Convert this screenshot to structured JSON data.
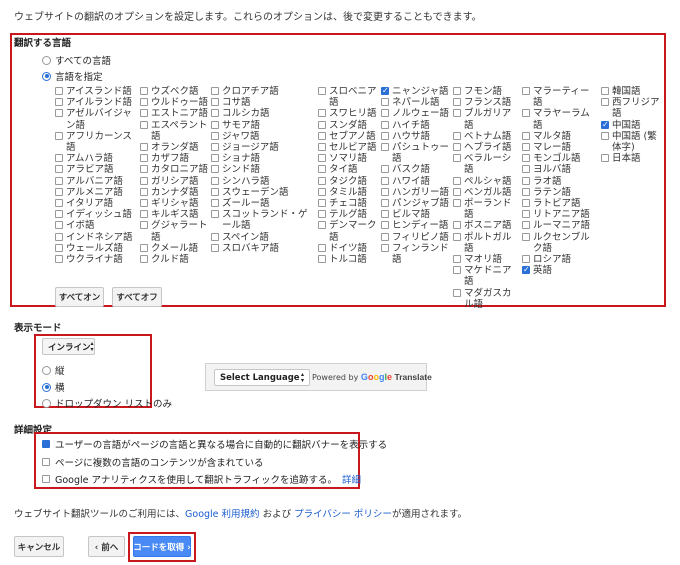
{
  "intro": "ウェブサイトの翻訳のオプションを設定します。これらのオプションは、後で変更することもできます。",
  "languages_section": {
    "title": "翻訳する言語",
    "all_languages": "すべての言語",
    "specify_languages": "言語を指定",
    "columns": [
      [
        {
          "label": "アイスランド語",
          "checked": false
        },
        {
          "label": "アイルランド語",
          "checked": false
        },
        {
          "label": "アゼルバイジャン語",
          "checked": false
        },
        {
          "label": "アフリカーンス語",
          "checked": false
        },
        {
          "label": "アムハラ語",
          "checked": false
        },
        {
          "label": "アラビア語",
          "checked": false
        },
        {
          "label": "アルバニア語",
          "checked": false
        },
        {
          "label": "アルメニア語",
          "checked": false
        },
        {
          "label": "イタリア語",
          "checked": false
        },
        {
          "label": "イディッシュ語",
          "checked": false
        },
        {
          "label": "イボ語",
          "checked": false
        },
        {
          "label": "インドネシア語",
          "checked": false
        },
        {
          "label": "ウェールズ語",
          "checked": false
        },
        {
          "label": "ウクライナ語",
          "checked": false
        }
      ],
      [
        {
          "label": "ウズベク語",
          "checked": false
        },
        {
          "label": "ウルドゥー語",
          "checked": false
        },
        {
          "label": "エストニア語",
          "checked": false
        },
        {
          "label": "エスペラント語",
          "checked": false
        },
        {
          "label": "オランダ語",
          "checked": false
        },
        {
          "label": "カザフ語",
          "checked": false
        },
        {
          "label": "カタロニア語",
          "checked": false
        },
        {
          "label": "ガリシア語",
          "checked": false
        },
        {
          "label": "カンナダ語",
          "checked": false
        },
        {
          "label": "ギリシャ語",
          "checked": false
        },
        {
          "label": "キルギス語",
          "checked": false
        },
        {
          "label": "グジャラート語",
          "checked": false
        },
        {
          "label": "クメール語",
          "checked": false
        },
        {
          "label": "クルド語",
          "checked": false
        }
      ],
      [
        {
          "label": "クロアチア語",
          "checked": false
        },
        {
          "label": "コサ語",
          "checked": false
        },
        {
          "label": "コルシカ語",
          "checked": false
        },
        {
          "label": "サモア語",
          "checked": false
        },
        {
          "label": "ジャワ語",
          "checked": false
        },
        {
          "label": "ジョージア語",
          "checked": false
        },
        {
          "label": "ショナ語",
          "checked": false
        },
        {
          "label": "シンド語",
          "checked": false
        },
        {
          "label": "シンハラ語",
          "checked": false
        },
        {
          "label": "スウェーデン語",
          "checked": false
        },
        {
          "label": "ズールー語",
          "checked": false
        },
        {
          "label": "スコットランド・ゲール語",
          "checked": false
        },
        {
          "label": "スペイン語",
          "checked": false
        },
        {
          "label": "スロバキア語",
          "checked": false
        }
      ],
      [
        {
          "label": "スロベニア語",
          "checked": false
        },
        {
          "label": "スワヒリ語",
          "checked": false
        },
        {
          "label": "スンダ語",
          "checked": false
        },
        {
          "label": "セブアノ語",
          "checked": false
        },
        {
          "label": "セルビア語",
          "checked": false
        },
        {
          "label": "ソマリ語",
          "checked": false
        },
        {
          "label": "タイ語",
          "checked": false
        },
        {
          "label": "タジク語",
          "checked": false
        },
        {
          "label": "タミル語",
          "checked": false
        },
        {
          "label": "チェコ語",
          "checked": false
        },
        {
          "label": "テルグ語",
          "checked": false
        },
        {
          "label": "デンマーク語",
          "checked": false
        },
        {
          "label": "ドイツ語",
          "checked": false
        },
        {
          "label": "トルコ語",
          "checked": false
        }
      ],
      [
        {
          "label": "ニャンジャ語",
          "checked": true
        },
        {
          "label": "ネパール語",
          "checked": false
        },
        {
          "label": "ノルウェー語",
          "checked": false
        },
        {
          "label": "ハイチ語",
          "checked": false
        },
        {
          "label": "ハウサ語",
          "checked": false
        },
        {
          "label": "パシュトゥー語",
          "checked": false
        },
        {
          "label": "バスク語",
          "checked": false
        },
        {
          "label": "ハワイ語",
          "checked": false
        },
        {
          "label": "ハンガリー語",
          "checked": false
        },
        {
          "label": "パンジャブ語",
          "checked": false
        },
        {
          "label": "ビルマ語",
          "checked": false
        },
        {
          "label": "ヒンディー語",
          "checked": false
        },
        {
          "label": "フィリピノ語",
          "checked": false
        },
        {
          "label": "フィンランド語",
          "checked": false
        }
      ],
      [
        {
          "label": "フモン語",
          "checked": false
        },
        {
          "label": "フランス語",
          "checked": false
        },
        {
          "label": "ブルガリア語",
          "checked": false
        },
        {
          "label": "ベトナム語",
          "checked": false
        },
        {
          "label": "ヘブライ語",
          "checked": false
        },
        {
          "label": "ベラルーシ語",
          "checked": false
        },
        {
          "label": "ペルシャ語",
          "checked": false
        },
        {
          "label": "ベンガル語",
          "checked": false
        },
        {
          "label": "ポーランド語",
          "checked": false
        },
        {
          "label": "ボスニア語",
          "checked": false
        },
        {
          "label": "ポルトガル語",
          "checked": false
        },
        {
          "label": "マオリ語",
          "checked": false
        },
        {
          "label": "マケドニア語",
          "checked": false
        },
        {
          "label": "マダガスカル語",
          "checked": false
        }
      ],
      [
        {
          "label": "マラーティー語",
          "checked": false
        },
        {
          "label": "マラヤーラム語",
          "checked": false
        },
        {
          "label": "マルタ語",
          "checked": false
        },
        {
          "label": "マレー語",
          "checked": false
        },
        {
          "label": "モンゴル語",
          "checked": false
        },
        {
          "label": "ヨルバ語",
          "checked": false
        },
        {
          "label": "ラオ語",
          "checked": false
        },
        {
          "label": "ラテン語",
          "checked": false
        },
        {
          "label": "ラトビア語",
          "checked": false
        },
        {
          "label": "リトアニア語",
          "checked": false
        },
        {
          "label": "ルーマニア語",
          "checked": false
        },
        {
          "label": "ルクセンブルク語",
          "checked": false
        },
        {
          "label": "ロシア語",
          "checked": false
        },
        {
          "label": "英語",
          "checked": true
        }
      ],
      [
        {
          "label": "韓国語",
          "checked": false
        },
        {
          "label": "西フリジア語",
          "checked": false
        },
        {
          "label": "中国語",
          "checked": true
        },
        {
          "label": "中国語 (繁体字)",
          "checked": false
        },
        {
          "label": "日本語",
          "checked": false
        }
      ]
    ],
    "select_all": "すべてオン",
    "select_none": "すべてオフ"
  },
  "display_mode": {
    "title": "表示モード",
    "dropdown_value": "インライン",
    "options": [
      "縦",
      "横",
      "ドロップダウン リストのみ"
    ],
    "selected": "横"
  },
  "widget_preview": {
    "select_label": "Select Language",
    "powered_by": "Powered by",
    "google": "Google",
    "translate": "Translate"
  },
  "advanced": {
    "title": "詳細設定",
    "options": [
      {
        "label": "ユーザーの言語がページの言語と異なる場合に自動的に翻訳バナーを表示する",
        "checked": true
      },
      {
        "label": "ページに複数の言語のコンテンツが含まれている",
        "checked": false
      },
      {
        "label": "Google アナリティクスを使用して翻訳トラフィックを追跡する。",
        "checked": false
      }
    ],
    "details_link": "詳細"
  },
  "terms": {
    "prefix": "ウェブサイト翻訳ツールのご利用には、",
    "tos_link": "Google 利用規約",
    "middle": " および ",
    "privacy_link": "プライバシー ポリシー",
    "suffix": "が適用されます。"
  },
  "buttons": {
    "cancel": "キャンセル",
    "back": "‹ 前へ",
    "get_code": "コードを取得 ›"
  },
  "colors": {
    "highlight_red": "#c8181e",
    "accent_blue": "#2a6fd6",
    "button_blue": "#4a8af4",
    "link_blue": "#1a5ccf"
  }
}
